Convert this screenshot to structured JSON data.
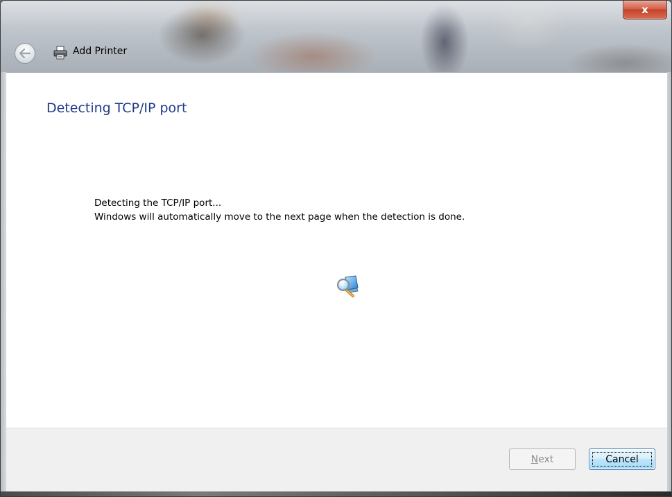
{
  "window": {
    "title": "Add Printer",
    "close_label": "x"
  },
  "page": {
    "heading": "Detecting TCP/IP port",
    "message_line1": "Detecting the TCP/IP port...",
    "message_line2": "Windows will automatically move to the next page when the detection is done."
  },
  "footer": {
    "next_mnemonic": "N",
    "next_rest": "ext",
    "next_enabled": false,
    "cancel_label": "Cancel"
  },
  "icons": {
    "back": "back-arrow-icon",
    "title": "printer-icon",
    "status": "search-computer-icon"
  },
  "colors": {
    "heading": "#1e3a8a",
    "close_button": "#c4422a",
    "focused_button_border": "#3c7fb1"
  }
}
